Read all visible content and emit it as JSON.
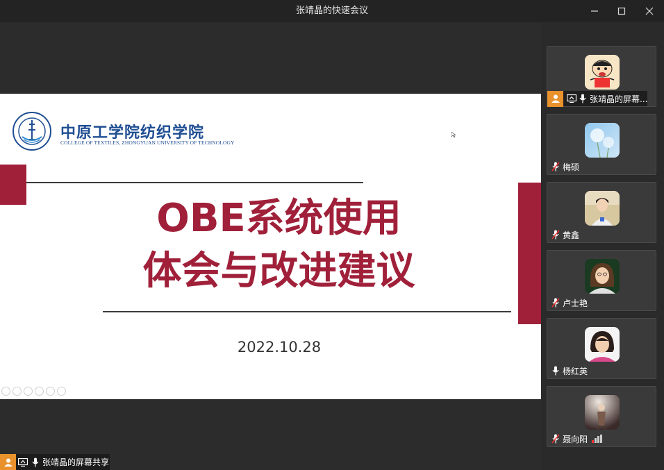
{
  "window": {
    "title": "张靖晶的快速会议"
  },
  "slide": {
    "logo_cn": "中原工学院纺织学院",
    "logo_en": "COLLEGE OF TEXTILES, ZHONGYUAN UNIVERSITY OF TECHNOLOGY",
    "title_line1": "OBE系统使用",
    "title_line2": "体会与改进建议",
    "date": "2022.10.28",
    "accent_color": "#a0203a",
    "logo_color": "#1f4e93"
  },
  "presenter_bar": {
    "label": "张靖晶的屏幕共享"
  },
  "participants": [
    {
      "name": "张靖晶的屏幕...",
      "mic": "on",
      "sharing": true,
      "host": true,
      "avatar": "cartoon-avatar"
    },
    {
      "name": "梅硕",
      "mic": "muted",
      "avatar": "dandelion-avatar"
    },
    {
      "name": "黄鑫",
      "mic": "muted",
      "avatar": "photo-avatar"
    },
    {
      "name": "卢士艳",
      "mic": "muted",
      "avatar": "photo-avatar"
    },
    {
      "name": "杨红英",
      "mic": "on",
      "avatar": "photo-avatar"
    },
    {
      "name": "聂向阳",
      "mic": "muted",
      "avatar": "photo-avatar",
      "signal": true
    }
  ]
}
